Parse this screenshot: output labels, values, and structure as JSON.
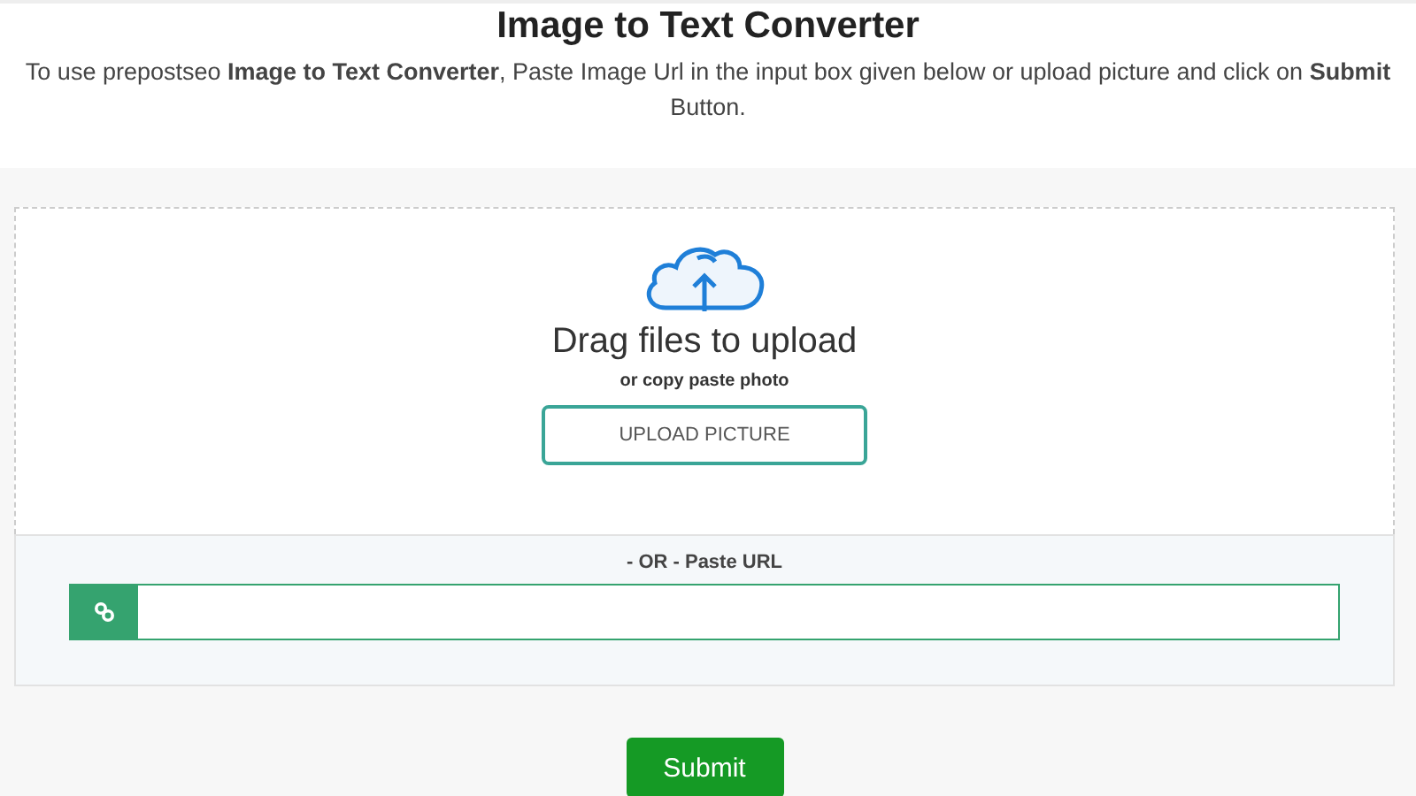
{
  "title": "Image to Text Converter",
  "intro": "To use prepostseo **Image to Text Converter**, Paste Image Url in the input box given below or upload picture and click on **Submit** Button.",
  "upload": {
    "heading": "Drag files to upload",
    "subheading": "or copy paste photo",
    "button": "UPLOAD PICTURE"
  },
  "url": {
    "label": "- OR - Paste URL"
  },
  "submit": "Submit"
}
